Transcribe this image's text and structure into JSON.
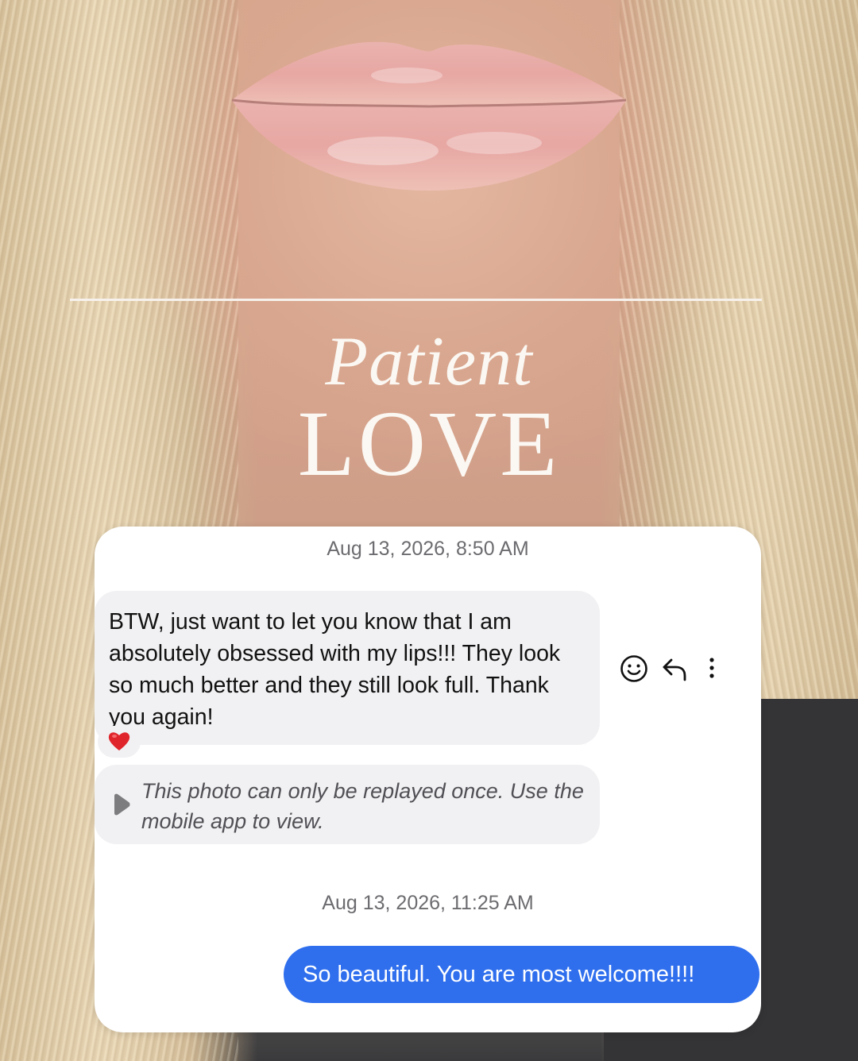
{
  "hero": {
    "title_script": "Patient",
    "title_main": "LOVE"
  },
  "chat": {
    "messages": [
      {
        "timestamp": "Aug 13, 2026, 8:50 AM",
        "incoming_text": "BTW, just want to let you know that I am absolutely obsessed with my lips!!! They look so much better and they still look full. Thank you again!",
        "reaction": "heart-emoji",
        "photo_notice": "This photo can only be replayed once. Use the mobile app to view."
      },
      {
        "timestamp": "Aug 13, 2026, 11:25 AM",
        "outgoing_text": "So beautiful. You are most welcome!!!!"
      }
    ],
    "action_icons": [
      "smiley-face-icon",
      "reply-icon",
      "more-options-icon"
    ]
  },
  "colors": {
    "outgoing_bubble": "#2f6fee",
    "incoming_bubble": "#f1f1f3",
    "title_text": "#fbf7f2",
    "reaction_heart": "#e0242b"
  }
}
